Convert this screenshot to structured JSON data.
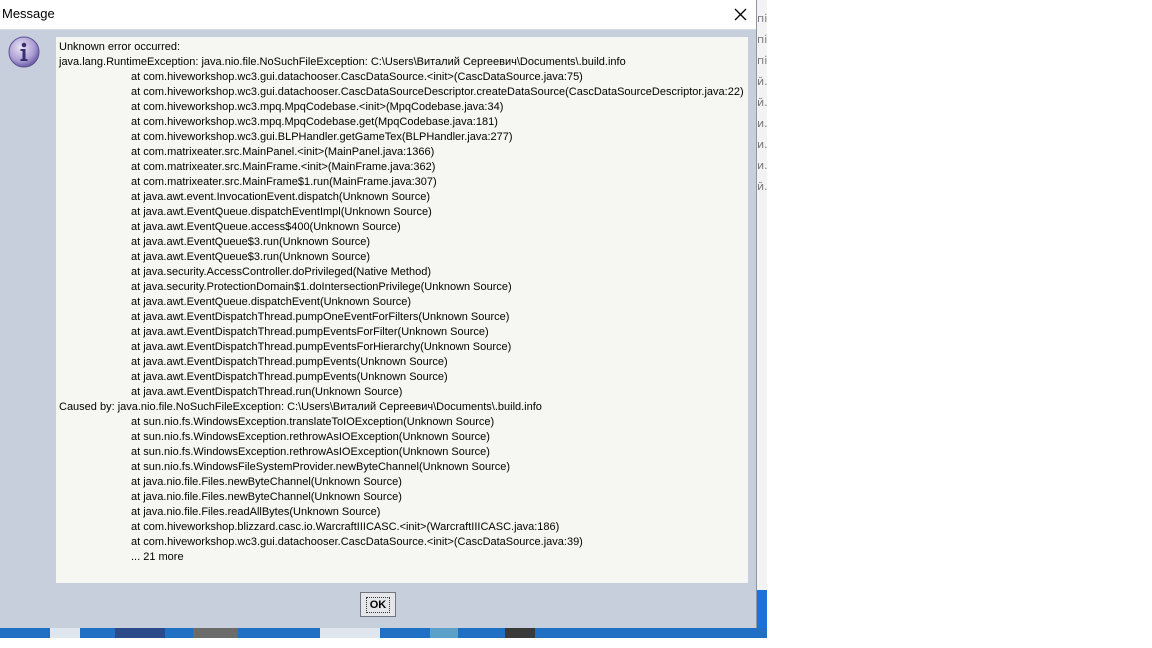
{
  "window": {
    "title": "Message"
  },
  "icons": {
    "info": "info-icon",
    "close": "close-icon"
  },
  "message": {
    "lines": [
      {
        "text": "Unknown error occurred:",
        "indent": false
      },
      {
        "text": "java.lang.RuntimeException: java.nio.file.NoSuchFileException: C:\\Users\\Виталий Сергеевич\\Documents\\.build.info",
        "indent": false
      },
      {
        "text": "at com.hiveworkshop.wc3.gui.datachooser.CascDataSource.<init>(CascDataSource.java:75)",
        "indent": true
      },
      {
        "text": "at com.hiveworkshop.wc3.gui.datachooser.CascDataSourceDescriptor.createDataSource(CascDataSourceDescriptor.java:22)",
        "indent": true
      },
      {
        "text": "at com.hiveworkshop.wc3.mpq.MpqCodebase.<init>(MpqCodebase.java:34)",
        "indent": true
      },
      {
        "text": "at com.hiveworkshop.wc3.mpq.MpqCodebase.get(MpqCodebase.java:181)",
        "indent": true
      },
      {
        "text": "at com.hiveworkshop.wc3.gui.BLPHandler.getGameTex(BLPHandler.java:277)",
        "indent": true
      },
      {
        "text": "at com.matrixeater.src.MainPanel.<init>(MainPanel.java:1366)",
        "indent": true
      },
      {
        "text": "at com.matrixeater.src.MainFrame.<init>(MainFrame.java:362)",
        "indent": true
      },
      {
        "text": "at com.matrixeater.src.MainFrame$1.run(MainFrame.java:307)",
        "indent": true
      },
      {
        "text": "at java.awt.event.InvocationEvent.dispatch(Unknown Source)",
        "indent": true
      },
      {
        "text": "at java.awt.EventQueue.dispatchEventImpl(Unknown Source)",
        "indent": true
      },
      {
        "text": "at java.awt.EventQueue.access$400(Unknown Source)",
        "indent": true
      },
      {
        "text": "at java.awt.EventQueue$3.run(Unknown Source)",
        "indent": true
      },
      {
        "text": "at java.awt.EventQueue$3.run(Unknown Source)",
        "indent": true
      },
      {
        "text": "at java.security.AccessController.doPrivileged(Native Method)",
        "indent": true
      },
      {
        "text": "at java.security.ProtectionDomain$1.doIntersectionPrivilege(Unknown Source)",
        "indent": true
      },
      {
        "text": "at java.awt.EventQueue.dispatchEvent(Unknown Source)",
        "indent": true
      },
      {
        "text": "at java.awt.EventDispatchThread.pumpOneEventForFilters(Unknown Source)",
        "indent": true
      },
      {
        "text": "at java.awt.EventDispatchThread.pumpEventsForFilter(Unknown Source)",
        "indent": true
      },
      {
        "text": "at java.awt.EventDispatchThread.pumpEventsForHierarchy(Unknown Source)",
        "indent": true
      },
      {
        "text": "at java.awt.EventDispatchThread.pumpEvents(Unknown Source)",
        "indent": true
      },
      {
        "text": "at java.awt.EventDispatchThread.pumpEvents(Unknown Source)",
        "indent": true
      },
      {
        "text": "at java.awt.EventDispatchThread.run(Unknown Source)",
        "indent": true
      },
      {
        "text": "Caused by: java.nio.file.NoSuchFileException: C:\\Users\\Виталий Сергеевич\\Documents\\.build.info",
        "indent": false
      },
      {
        "text": "at sun.nio.fs.WindowsException.translateToIOException(Unknown Source)",
        "indent": true
      },
      {
        "text": "at sun.nio.fs.WindowsException.rethrowAsIOException(Unknown Source)",
        "indent": true
      },
      {
        "text": "at sun.nio.fs.WindowsException.rethrowAsIOException(Unknown Source)",
        "indent": true
      },
      {
        "text": "at sun.nio.fs.WindowsFileSystemProvider.newByteChannel(Unknown Source)",
        "indent": true
      },
      {
        "text": "at java.nio.file.Files.newByteChannel(Unknown Source)",
        "indent": true
      },
      {
        "text": "at java.nio.file.Files.newByteChannel(Unknown Source)",
        "indent": true
      },
      {
        "text": "at java.nio.file.Files.readAllBytes(Unknown Source)",
        "indent": true
      },
      {
        "text": "at com.hiveworkshop.blizzard.casc.io.WarcraftIIICASC.<init>(WarcraftIIICASC.java:186)",
        "indent": true
      },
      {
        "text": "at com.hiveworkshop.wc3.gui.datachooser.CascDataSource.<init>(CascDataSource.java:39)",
        "indent": true
      },
      {
        "text": "... 21 more",
        "indent": true
      }
    ]
  },
  "buttons": {
    "ok_label": "OK"
  },
  "background": {
    "fragments": [
      "пі",
      "пі",
      "пі",
      "й.",
      "й.",
      "и.",
      "и.",
      "и.",
      "й."
    ]
  },
  "colors": {
    "dialog_bg": "#c7cfdd",
    "message_bg": "#f6f6f2",
    "taskbar": "#1a73d9"
  }
}
